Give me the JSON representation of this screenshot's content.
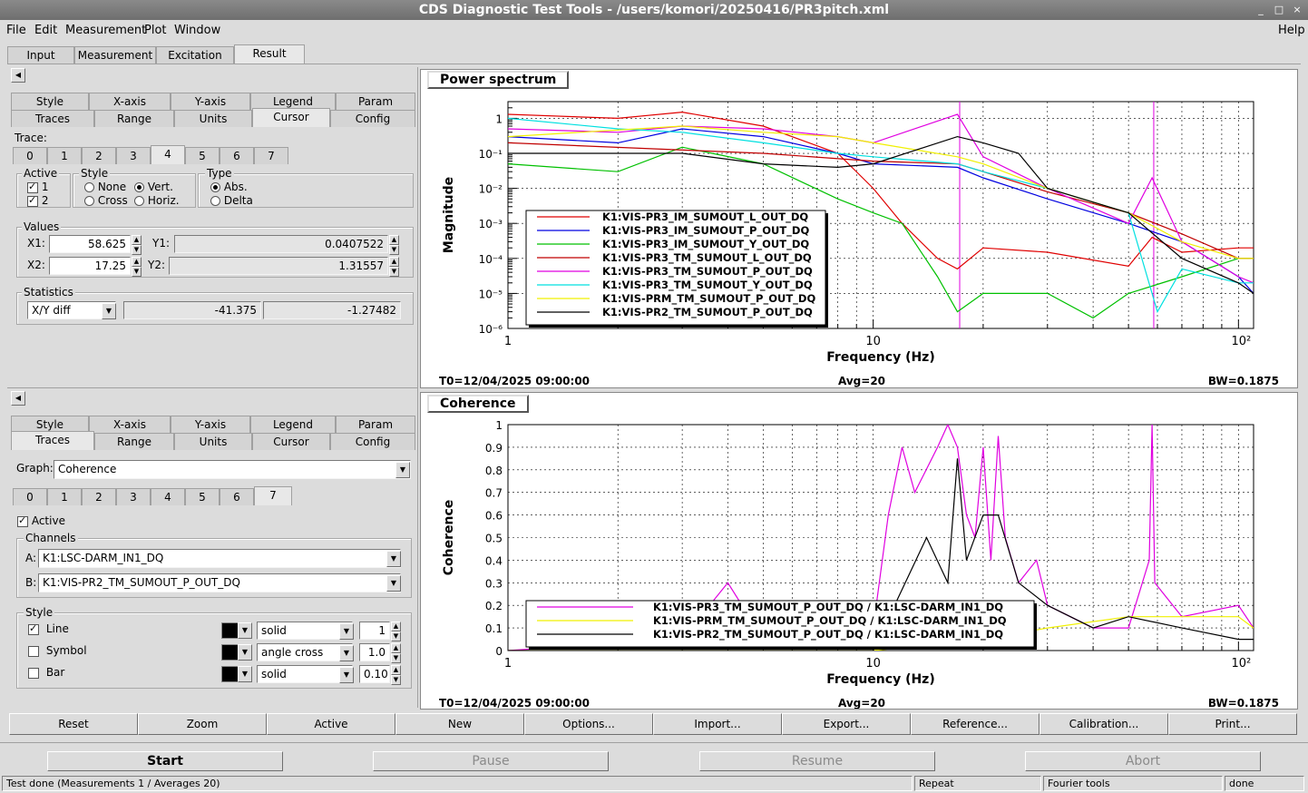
{
  "window": {
    "title": "CDS Diagnostic Test Tools - /users/komori/20250416/PR3pitch.xml",
    "controls": [
      "_",
      "□",
      "×"
    ]
  },
  "menu": {
    "file": "File",
    "edit": "Edit",
    "measurement": "Measurement",
    "plot": "Plot",
    "window": "Window",
    "help": "Help"
  },
  "main_tabs": [
    "Input",
    "Measurement",
    "Excitation",
    "Result"
  ],
  "upper": {
    "subtabs_row1": [
      "Style",
      "X-axis",
      "Y-axis",
      "Legend",
      "Param"
    ],
    "subtabs_row2": [
      "Traces",
      "Range",
      "Units",
      "Cursor",
      "Config"
    ],
    "trace_label": "Trace:",
    "trace_tabs": [
      "0",
      "1",
      "2",
      "3",
      "4",
      "5",
      "6",
      "7"
    ],
    "active_label": "Active",
    "active_1": "1",
    "active_2": "2",
    "style_label": "Style",
    "style_none": "None",
    "style_vert": "Vert.",
    "style_cross": "Cross",
    "style_horiz": "Horiz.",
    "type_label": "Type",
    "type_abs": "Abs.",
    "type_delta": "Delta",
    "values_label": "Values",
    "x1_label": "X1:",
    "x1_value": "58.625",
    "y1_label": "Y1:",
    "y1_value": "0.0407522",
    "x2_label": "X2:",
    "x2_value": "17.25",
    "y2_label": "Y2:",
    "y2_value": "1.31557",
    "statistics_label": "Statistics",
    "stat_mode": "X/Y diff",
    "stat_x": "-41.375",
    "stat_y": "-1.27482"
  },
  "lower": {
    "subtabs_row1": [
      "Style",
      "X-axis",
      "Y-axis",
      "Legend",
      "Param"
    ],
    "subtabs_row2": [
      "Traces",
      "Range",
      "Units",
      "Cursor",
      "Config"
    ],
    "graph_label": "Graph:",
    "graph_value": "Coherence",
    "trace_tabs": [
      "0",
      "1",
      "2",
      "3",
      "4",
      "5",
      "6",
      "7"
    ],
    "active_label": "Active",
    "channels_label": "Channels",
    "a_label": "A:",
    "a_value": "K1:LSC-DARM_IN1_DQ",
    "b_label": "B:",
    "b_value": "K1:VIS-PR2_TM_SUMOUT_P_OUT_DQ",
    "style_label": "Style",
    "line_label": "Line",
    "line_style": "solid",
    "line_width": "1",
    "symbol_label": "Symbol",
    "symbol_style": "angle cross",
    "symbol_size": "1.0",
    "bar_label": "Bar",
    "bar_style": "solid",
    "bar_width": "0.10"
  },
  "toolbar": [
    "Reset",
    "Zoom",
    "Active",
    "New",
    "Options...",
    "Import...",
    "Export...",
    "Reference...",
    "Calibration...",
    "Print..."
  ],
  "actions": {
    "start": "Start",
    "pause": "Pause",
    "resume": "Resume",
    "abort": "Abort"
  },
  "statusbar": {
    "message": "Test done (Measurements 1 / Averages 20)",
    "repeat": "Repeat",
    "fourier": "Fourier tools",
    "state": "done"
  },
  "colors": {
    "red": "#e00000",
    "blue": "#0000e0",
    "green": "#00c000",
    "darkred": "#c00000",
    "magenta": "#e000e0",
    "cyan": "#00e0e0",
    "yellow": "#f0f000",
    "black": "#000000"
  },
  "chart_data": [
    {
      "type": "line",
      "title": "Power spectrum",
      "xlabel": "Frequency (Hz)",
      "ylabel": "Magnitude",
      "xscale": "log",
      "yscale": "log",
      "xlim": [
        1,
        110
      ],
      "ylim": [
        1e-06,
        3
      ],
      "x_ticks": [
        "1",
        "10",
        "10²"
      ],
      "y_ticks": [
        "10⁻⁶",
        "10⁻⁵",
        "10⁻⁴",
        "10⁻³",
        "10⁻²",
        "10⁻¹",
        "1"
      ],
      "footer": {
        "t0": "T0=12/04/2025 09:00:00",
        "avg": "Avg=20",
        "bw": "BW=0.1875"
      },
      "cursors_x": [
        17.25,
        58.625
      ],
      "legend_position": "bottom-left",
      "grid": true,
      "series": [
        {
          "name": "K1:VIS-PR3_IM_SUMOUT_L_OUT_DQ",
          "color": "#e00000",
          "x": [
            1,
            2,
            3,
            5,
            8,
            10,
            12,
            15,
            17,
            20,
            30,
            50,
            58,
            70,
            100,
            110
          ],
          "y": [
            1.3,
            1.0,
            1.5,
            0.6,
            0.1,
            0.01,
            0.001,
            0.0001,
            5e-05,
            0.0002,
            0.00015,
            6e-05,
            0.0004,
            0.00015,
            0.0002,
            0.0002
          ]
        },
        {
          "name": "K1:VIS-PR3_IM_SUMOUT_P_OUT_DQ",
          "color": "#0000e0",
          "x": [
            1,
            2,
            3,
            5,
            8,
            10,
            17,
            20,
            30,
            50,
            70,
            100,
            110
          ],
          "y": [
            0.3,
            0.2,
            0.5,
            0.3,
            0.1,
            0.05,
            0.04,
            0.02,
            0.005,
            0.001,
            0.0003,
            3e-05,
            1e-05
          ]
        },
        {
          "name": "K1:VIS-PR3_IM_SUMOUT_Y_OUT_DQ",
          "color": "#00c000",
          "x": [
            1,
            2,
            3,
            5,
            8,
            10,
            12,
            15,
            17,
            20,
            30,
            40,
            50,
            70,
            100,
            110
          ],
          "y": [
            0.05,
            0.03,
            0.15,
            0.05,
            0.005,
            0.002,
            0.001,
            3e-05,
            3e-06,
            1e-05,
            1e-05,
            2e-06,
            1e-05,
            3e-05,
            0.0001,
            0.0001
          ]
        },
        {
          "name": "K1:VIS-PR3_TM_SUMOUT_L_OUT_DQ",
          "color": "#c00000",
          "x": [
            1,
            5,
            10,
            17,
            20,
            30,
            50,
            70,
            100,
            110
          ],
          "y": [
            0.2,
            0.1,
            0.06,
            0.05,
            0.03,
            0.008,
            0.002,
            0.0005,
            0.0001,
            0.0001
          ]
        },
        {
          "name": "K1:VIS-PR3_TM_SUMOUT_P_OUT_DQ",
          "color": "#e000e0",
          "x": [
            1,
            2,
            3,
            5,
            8,
            10,
            17,
            20,
            30,
            50,
            58,
            70,
            100,
            110
          ],
          "y": [
            0.5,
            0.4,
            0.6,
            0.5,
            0.3,
            0.2,
            1.3,
            0.08,
            0.01,
            0.001,
            0.02,
            0.0003,
            3e-05,
            2e-05
          ]
        },
        {
          "name": "K1:VIS-PR3_TM_SUMOUT_Y_OUT_DQ",
          "color": "#00e0e0",
          "x": [
            1,
            2,
            3,
            5,
            8,
            10,
            17,
            20,
            30,
            50,
            60,
            70,
            100,
            110
          ],
          "y": [
            1.0,
            0.5,
            0.4,
            0.2,
            0.1,
            0.08,
            0.05,
            0.03,
            0.01,
            0.002,
            3e-06,
            5e-05,
            2e-05,
            2e-05
          ]
        },
        {
          "name": "K1:VIS-PRM_TM_SUMOUT_P_OUT_DQ",
          "color": "#f0f000",
          "x": [
            1,
            3,
            5,
            8,
            10,
            17,
            20,
            30,
            50,
            70,
            100,
            110
          ],
          "y": [
            0.3,
            0.6,
            0.4,
            0.3,
            0.2,
            0.08,
            0.05,
            0.01,
            0.002,
            0.0003,
            0.0001,
            0.0001
          ]
        },
        {
          "name": "K1:VIS-PR2_TM_SUMOUT_P_OUT_DQ",
          "color": "#000000",
          "x": [
            1,
            3,
            5,
            8,
            10,
            17,
            20,
            25,
            30,
            50,
            70,
            100,
            110
          ],
          "y": [
            0.1,
            0.1,
            0.05,
            0.04,
            0.05,
            0.3,
            0.2,
            0.1,
            0.01,
            0.002,
            0.0001,
            2e-05,
            1e-05
          ]
        }
      ]
    },
    {
      "type": "line",
      "title": "Coherence",
      "xlabel": "Frequency (Hz)",
      "ylabel": "Coherence",
      "xscale": "log",
      "xlim": [
        1,
        110
      ],
      "ylim": [
        0,
        1
      ],
      "x_ticks": [
        "1",
        "10",
        "10²"
      ],
      "y_ticks": [
        "0",
        "0.1",
        "0.2",
        "0.3",
        "0.4",
        "0.5",
        "0.6",
        "0.7",
        "0.8",
        "0.9",
        "1"
      ],
      "footer": {
        "t0": "T0=12/04/2025 09:00:00",
        "avg": "Avg=20",
        "bw": "BW=0.1875"
      },
      "legend_position": "bottom-left",
      "grid": true,
      "series": [
        {
          "name": "K1:VIS-PR3_TM_SUMOUT_P_OUT_DQ / K1:LSC-DARM_IN1_DQ",
          "color": "#e000e0",
          "x": [
            1,
            3,
            4,
            5,
            8,
            10,
            11,
            12,
            13,
            15,
            16,
            17,
            18,
            19,
            20,
            21,
            22,
            23,
            25,
            28,
            30,
            40,
            50,
            57,
            58,
            59,
            70,
            100,
            110
          ],
          "y": [
            0.0,
            0.05,
            0.3,
            0.05,
            0.05,
            0.1,
            0.6,
            0.9,
            0.7,
            0.9,
            1.0,
            0.9,
            0.6,
            0.5,
            0.9,
            0.4,
            0.95,
            0.5,
            0.3,
            0.4,
            0.2,
            0.1,
            0.1,
            0.4,
            1.0,
            0.3,
            0.15,
            0.2,
            0.1
          ]
        },
        {
          "name": "K1:VIS-PRM_TM_SUMOUT_P_OUT_DQ / K1:LSC-DARM_IN1_DQ",
          "color": "#f0f000",
          "x": [
            1,
            10,
            20,
            30,
            50,
            70,
            100,
            110
          ],
          "y": [
            0.0,
            0.0,
            0.05,
            0.1,
            0.15,
            0.15,
            0.15,
            0.1
          ]
        },
        {
          "name": "K1:VIS-PR2_TM_SUMOUT_P_OUT_DQ / K1:LSC-DARM_IN1_DQ",
          "color": "#000000",
          "x": [
            1,
            10,
            14,
            16,
            17,
            18,
            20,
            22,
            25,
            30,
            40,
            50,
            70,
            100,
            110
          ],
          "y": [
            0.0,
            0.0,
            0.5,
            0.3,
            0.85,
            0.4,
            0.6,
            0.6,
            0.3,
            0.2,
            0.1,
            0.15,
            0.1,
            0.05,
            0.05
          ]
        }
      ]
    }
  ]
}
